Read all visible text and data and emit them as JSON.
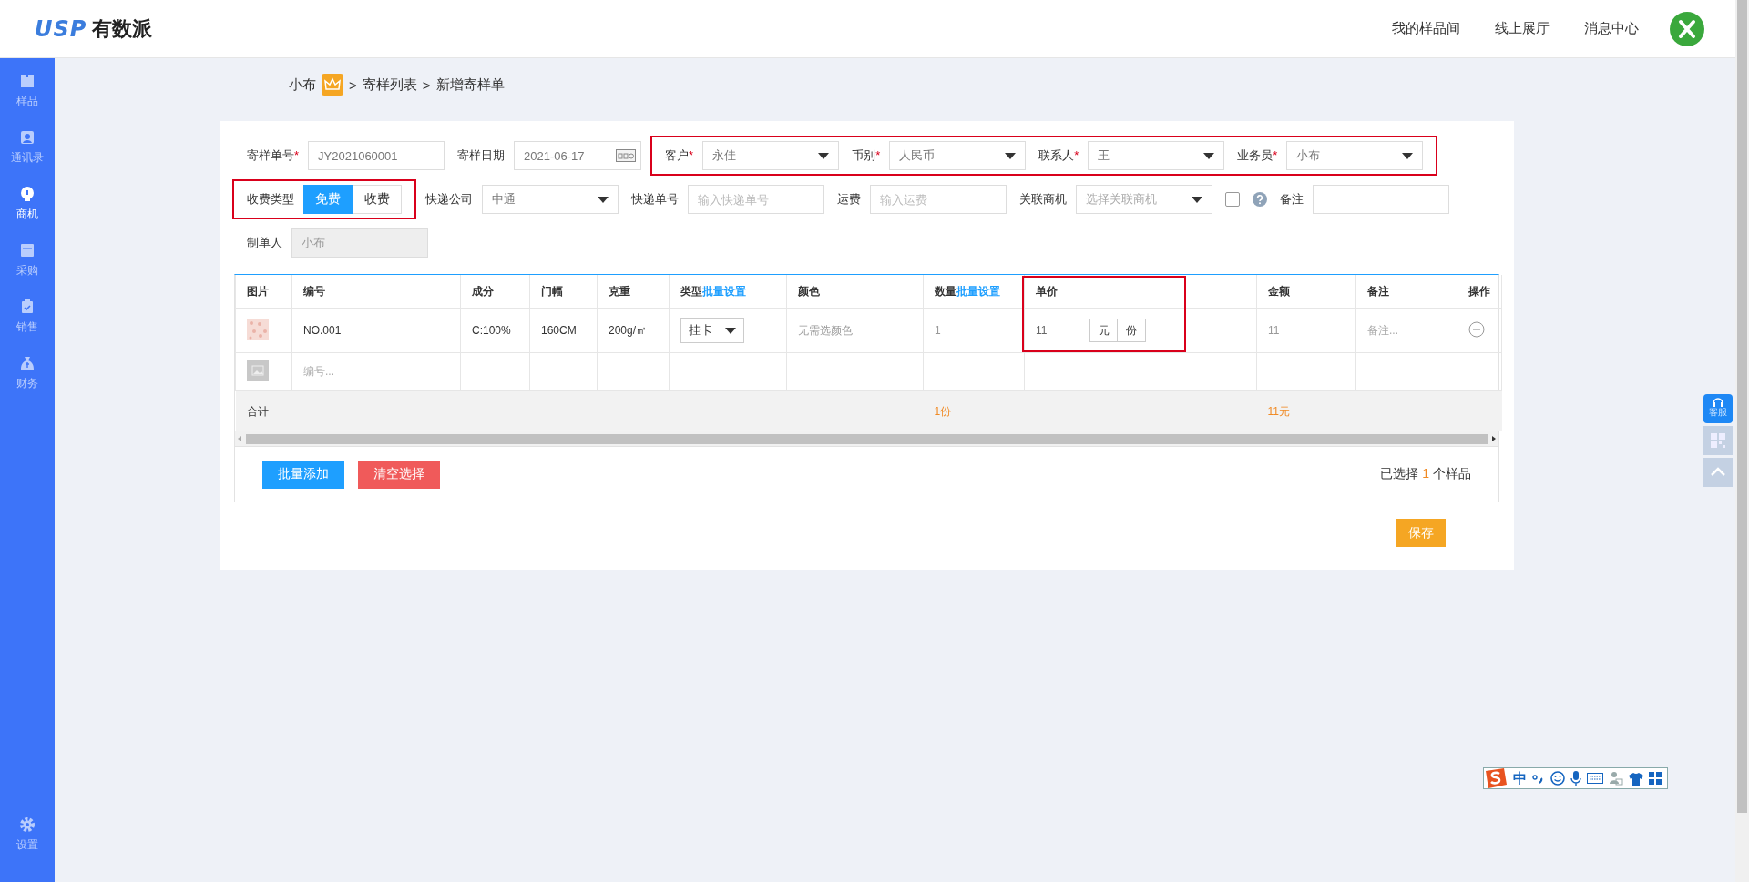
{
  "header": {
    "logo_mark": "USP",
    "logo_text": "有数派",
    "nav": [
      "我的样品间",
      "线上展厅",
      "消息中心"
    ]
  },
  "sidebar": {
    "items": [
      {
        "label": "样品",
        "selected": false
      },
      {
        "label": "通讯录",
        "selected": false
      },
      {
        "label": "商机",
        "selected": true
      },
      {
        "label": "采购",
        "selected": false
      },
      {
        "label": "销售",
        "selected": false
      },
      {
        "label": "财务",
        "selected": false
      }
    ],
    "settings": "设置"
  },
  "breadcrumb": {
    "user": "小布",
    "separator": ">",
    "items": [
      "寄样列表",
      "新增寄样单"
    ]
  },
  "form": {
    "required_mark": "*",
    "rows": [
      {
        "groups": [
          {
            "highlighted": false,
            "fields": [
              {
                "kind": "input",
                "label": "寄样单号",
                "required": true,
                "value": "JY2021060001",
                "disabled": false
              },
              {
                "kind": "date",
                "label": "寄样日期",
                "required": false,
                "value": "2021-06-17"
              }
            ]
          },
          {
            "highlighted": true,
            "fields": [
              {
                "kind": "select",
                "label": "客户",
                "required": true,
                "value": "永佳"
              },
              {
                "kind": "select",
                "label": "币别",
                "required": true,
                "value": "人民币"
              },
              {
                "kind": "select",
                "label": "联系人",
                "required": true,
                "value": "王"
              },
              {
                "kind": "select",
                "label": "业务员",
                "required": true,
                "value": "小布"
              }
            ]
          }
        ]
      },
      {
        "groups": [
          {
            "highlighted": true,
            "fields": [
              {
                "kind": "toggle",
                "label": "收费类型",
                "required": false,
                "options": [
                  {
                    "label": "免费",
                    "selected": true
                  },
                  {
                    "label": "收费",
                    "selected": false
                  }
                ]
              }
            ]
          },
          {
            "highlighted": false,
            "fields": [
              {
                "kind": "select",
                "label": "快递公司",
                "required": false,
                "value": "中通"
              },
              {
                "kind": "input",
                "label": "快递单号",
                "required": false,
                "placeholder": "输入快递单号",
                "disabled": false
              },
              {
                "kind": "input",
                "label": "运费",
                "required": false,
                "placeholder": "输入运费",
                "disabled": false
              },
              {
                "kind": "select",
                "label": "关联商机",
                "required": false,
                "placeholder": "选择关联商机"
              },
              {
                "kind": "checkbox",
                "checked": false
              },
              {
                "kind": "help"
              },
              {
                "kind": "input",
                "label": "备注",
                "required": false,
                "disabled": false
              }
            ]
          }
        ]
      },
      {
        "groups": [
          {
            "highlighted": false,
            "fields": [
              {
                "kind": "input",
                "label": "制单人",
                "required": false,
                "value": "小布",
                "disabled": true
              }
            ]
          }
        ]
      }
    ]
  },
  "table": {
    "columns": [
      {
        "label": "图片",
        "highlighted": false
      },
      {
        "label": "编号",
        "highlighted": false
      },
      {
        "label": "成分",
        "highlighted": false
      },
      {
        "label": "门幅",
        "highlighted": false
      },
      {
        "label": "克重",
        "highlighted": false
      },
      {
        "label": "类型",
        "link": "批量设置",
        "highlighted": false
      },
      {
        "label": "颜色",
        "highlighted": false
      },
      {
        "label": "数量",
        "link": "批量设置",
        "highlighted": false
      },
      {
        "label": "单价",
        "highlighted": true
      },
      {
        "label": "金额",
        "highlighted": false
      },
      {
        "label": "备注",
        "highlighted": false
      },
      {
        "label": "操作",
        "highlighted": false
      }
    ],
    "rows": [
      {
        "cells": [
          {
            "kind": "picture"
          },
          {
            "kind": "text",
            "text": "NO.001"
          },
          {
            "kind": "text",
            "text": "C:100%"
          },
          {
            "kind": "text",
            "text": "160CM"
          },
          {
            "kind": "text",
            "text": "200g/㎡"
          },
          {
            "kind": "select",
            "value": "挂卡"
          },
          {
            "kind": "muted",
            "text": "无需选颜色"
          },
          {
            "kind": "muted",
            "text": "1"
          },
          {
            "kind": "price",
            "value": "11",
            "units": [
              "元",
              "份"
            ]
          },
          {
            "kind": "muted",
            "text": "11"
          },
          {
            "kind": "placeholder",
            "text": "备注..."
          },
          {
            "kind": "remove"
          }
        ]
      },
      {
        "cells": [
          {
            "kind": "image-placeholder"
          },
          {
            "kind": "placeholder",
            "text": "编号..."
          },
          {
            "kind": "empty"
          },
          {
            "kind": "empty"
          },
          {
            "kind": "empty"
          },
          {
            "kind": "empty"
          },
          {
            "kind": "empty"
          },
          {
            "kind": "empty"
          },
          {
            "kind": "empty"
          },
          {
            "kind": "empty"
          },
          {
            "kind": "empty"
          },
          {
            "kind": "empty"
          }
        ]
      }
    ],
    "totals": {
      "label": "合计",
      "quantity": "1份",
      "amount": "11元"
    }
  },
  "footer": {
    "buttons": [
      {
        "label": "批量添加",
        "kind": "primary"
      },
      {
        "label": "清空选择",
        "kind": "danger"
      }
    ],
    "selection": {
      "prefix": "已选择",
      "count": "1",
      "suffix": "个样品"
    }
  },
  "save": "保存",
  "float_tools": {
    "service": "客服"
  },
  "ime_bar": {
    "mode": "中"
  }
}
